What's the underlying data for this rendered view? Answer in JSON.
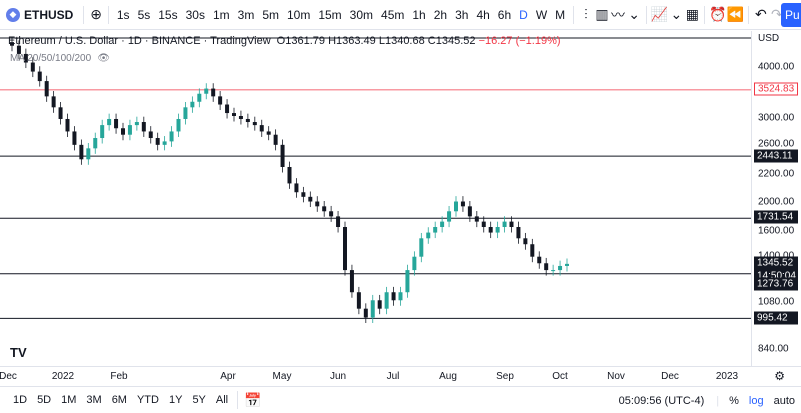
{
  "toolbar": {
    "symbol": "ETHUSD",
    "add_symbol": "+",
    "intervals": [
      "1s",
      "5s",
      "15s",
      "30s",
      "1m",
      "3m",
      "5m",
      "10m",
      "15m",
      "30m",
      "45m",
      "1h",
      "2h",
      "3h",
      "4h",
      "6h",
      "D",
      "W",
      "M"
    ],
    "active_interval": "D",
    "publish": "Pu"
  },
  "legend": {
    "title": "Ethereum / U.S. Dollar · 1D · BINANCE · TradingView",
    "open": "O1361.79",
    "high": "H1363.49",
    "low": "L1340.68",
    "close": "C1345.52",
    "change": "−16.27 (−1.19%)",
    "ma": "MA 20/50/100/200"
  },
  "price_scale": {
    "currency": "USD",
    "ticks": [
      "4000.00",
      "3000.00",
      "2600.00",
      "2200.00",
      "2000.00",
      "1600.00",
      "1400.00",
      "1080.00",
      "840.00"
    ],
    "tags": {
      "red": "3524.83",
      "lvl1": "2443.11",
      "lvl2": "1731.54",
      "current": "1345.52",
      "countdown": "14:50:04",
      "lvl3": "1273.76",
      "lvl4": "995.42"
    }
  },
  "time_scale": {
    "labels": [
      "Dec",
      "2022",
      "Feb",
      "Apr",
      "May",
      "Jun",
      "Jul",
      "Aug",
      "Sep",
      "Oct",
      "Nov",
      "Dec",
      "2023"
    ]
  },
  "bottom": {
    "ranges": [
      "1D",
      "5D",
      "1M",
      "3M",
      "6M",
      "YTD",
      "1Y",
      "5Y",
      "All"
    ],
    "clock": "05:09:56 (UTC-4)",
    "percent": "%",
    "log": "log",
    "auto": "auto"
  },
  "colors": {
    "up": "#26a69a",
    "down": "#131722",
    "resistance": "#f23645",
    "accent": "#2962ff"
  },
  "chart_data": {
    "type": "candlestick",
    "title": "Ethereum / U.S. Dollar · 1D · BINANCE",
    "log_scale": true,
    "close_series": [
      4500,
      4300,
      4100,
      3900,
      3700,
      3400,
      3200,
      3000,
      2800,
      2600,
      2400,
      2550,
      2700,
      2900,
      3000,
      2850,
      2750,
      2900,
      2950,
      2800,
      2700,
      2600,
      2650,
      2800,
      3000,
      3200,
      3300,
      3450,
      3550,
      3400,
      3250,
      3100,
      3050,
      3000,
      2950,
      2900,
      2800,
      2750,
      2600,
      2300,
      2100,
      2000,
      1950,
      1900,
      1850,
      1800,
      1750,
      1650,
      1300,
      1150,
      1050,
      1000,
      1100,
      1050,
      1150,
      1100,
      1150,
      1300,
      1400,
      1550,
      1600,
      1650,
      1700,
      1800,
      1900,
      1850,
      1750,
      1700,
      1650,
      1600,
      1650,
      1700,
      1650,
      1550,
      1500,
      1400,
      1350,
      1300,
      1300,
      1330,
      1345.52
    ],
    "horizontal_levels": [
      3524.83,
      2443.11,
      1731.54,
      1273.76,
      995.42
    ],
    "current_price": 1345.52
  }
}
